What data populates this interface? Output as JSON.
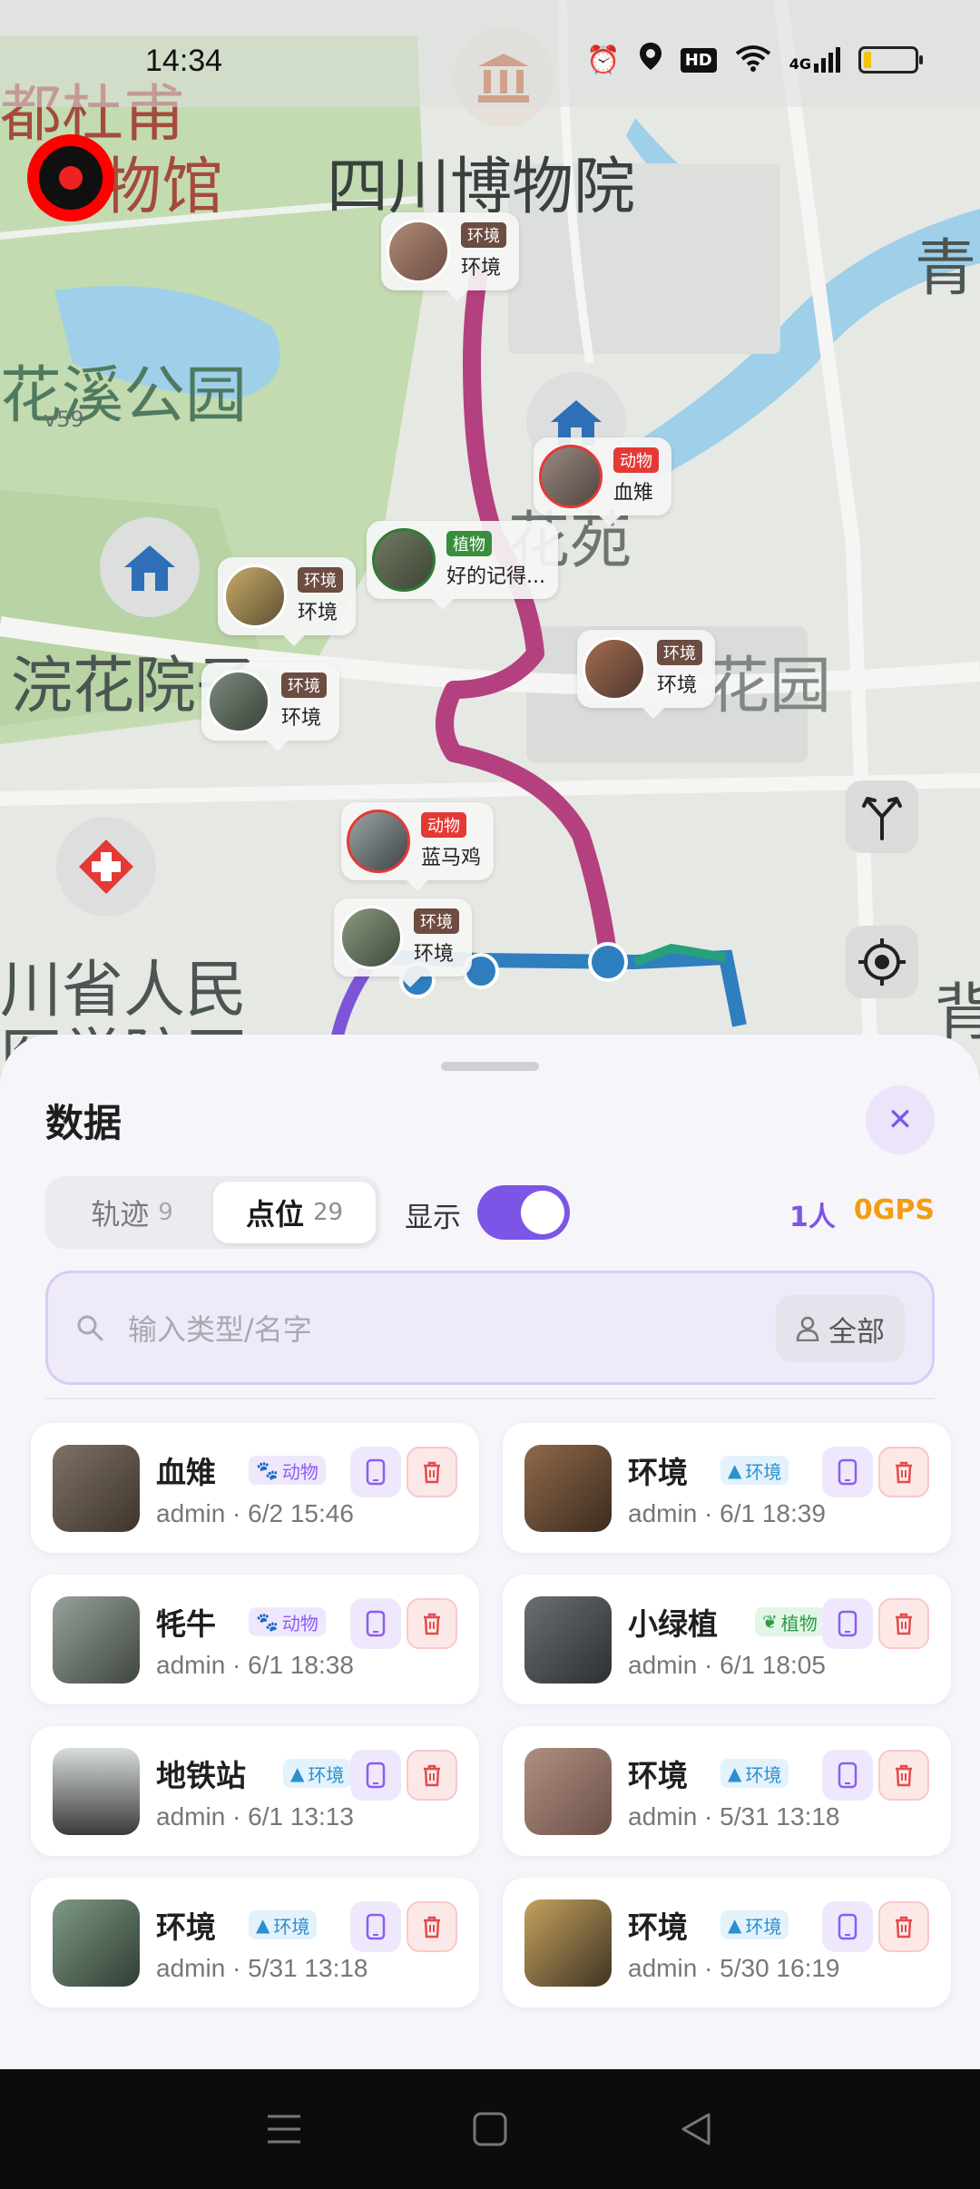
{
  "status_bar": {
    "time": "14:34",
    "network": "4G",
    "hd": "HD"
  },
  "map": {
    "labels": {
      "museum": "四川博物院",
      "park": "花溪公园",
      "dufu": "都杜甫",
      "guan": "物馆",
      "huanhua": "浣花院子",
      "caohua": "花苑",
      "huayuan": "花园",
      "hospital": "川省人民",
      "hospital2": "医学院区",
      "qing": "青",
      "bei": "背",
      "zone": "v59"
    },
    "markers": [
      {
        "tag": "环境",
        "name": "环境",
        "kind": "env"
      },
      {
        "tag": "动物",
        "name": "血雉",
        "kind": "ani"
      },
      {
        "tag": "植物",
        "name": "好的记得...",
        "kind": "pla"
      },
      {
        "tag": "环境",
        "name": "环境",
        "kind": "env"
      },
      {
        "tag": "环境",
        "name": "环境",
        "kind": "env"
      },
      {
        "tag": "环境",
        "name": "环境",
        "kind": "env"
      },
      {
        "tag": "动物",
        "name": "蓝马鸡",
        "kind": "ani"
      },
      {
        "tag": "环境",
        "name": "环境",
        "kind": "env"
      }
    ]
  },
  "sheet": {
    "title": "数据",
    "tabs": [
      {
        "label": "轨迹",
        "count": "9"
      },
      {
        "label": "点位",
        "count": "29"
      }
    ],
    "show_label": "显示",
    "show_enabled": true,
    "people": "1人",
    "gps": "0GPS",
    "search": {
      "placeholder": "输入类型/名字",
      "value": ""
    },
    "filter_label": "全部"
  },
  "records": [
    {
      "name": "血雉",
      "tag": "动物",
      "kind": "ani",
      "meta": "admin · 6/2 15:46"
    },
    {
      "name": "环境",
      "tag": "环境",
      "kind": "env",
      "meta": "admin · 6/1 18:39"
    },
    {
      "name": "牦牛",
      "tag": "动物",
      "kind": "ani",
      "meta": "admin · 6/1 18:38"
    },
    {
      "name": "小绿植",
      "tag": "植物",
      "kind": "pla",
      "meta": "admin · 6/1 18:05"
    },
    {
      "name": "地铁站",
      "tag": "环境",
      "kind": "env",
      "meta": "admin · 6/1 13:13"
    },
    {
      "name": "环境",
      "tag": "环境",
      "kind": "env",
      "meta": "admin · 5/31 13:18"
    },
    {
      "name": "环境",
      "tag": "环境",
      "kind": "env",
      "meta": "admin · 5/31 13:18"
    },
    {
      "name": "环境",
      "tag": "环境",
      "kind": "env",
      "meta": "admin · 5/30 16:19"
    }
  ],
  "colors": {
    "accent": "#7d55e6",
    "gps": "#f39c12",
    "route": "#b5407f"
  }
}
